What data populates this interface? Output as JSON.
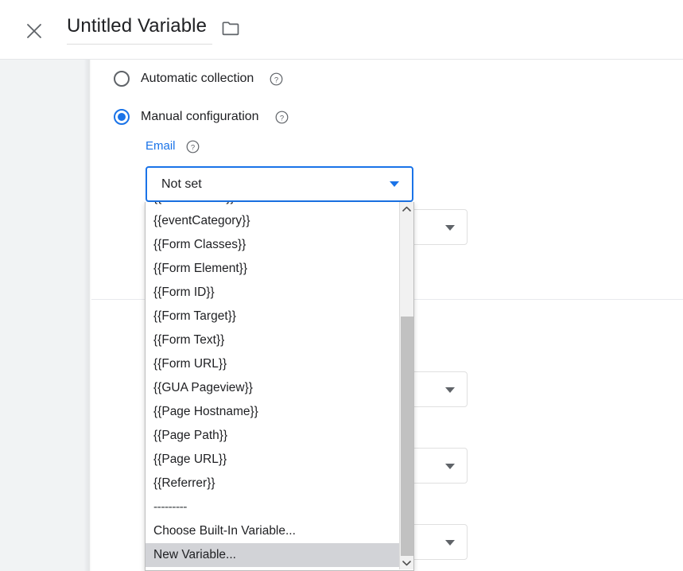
{
  "header": {
    "close_label": "close-icon",
    "title": "Untitled Variable",
    "folder_label": "folder-icon"
  },
  "colors": {
    "accent_blue": "#1a73e8",
    "text_primary": "#202124",
    "rail_gray": "#f1f3f4",
    "highlight_gray": "#d2d3d7",
    "scrollbar_thumb": "#c1c1c1"
  },
  "main": {
    "radio_options": [
      {
        "label": "Automatic collection",
        "selected": false
      },
      {
        "label": "Manual configuration",
        "selected": true
      }
    ],
    "email_field": {
      "label": "Email",
      "value": "Not set",
      "placeholder": "Not set"
    }
  },
  "dropdown": {
    "clipped_top_item": "{{eventAction}}",
    "items": [
      "{{eventCategory}}",
      "{{Form Classes}}",
      "{{Form Element}}",
      "{{Form ID}}",
      "{{Form Target}}",
      "{{Form Text}}",
      "{{Form URL}}",
      "{{GUA Pageview}}",
      "{{Page Hostname}}",
      "{{Page Path}}",
      "{{Page URL}}",
      "{{Referrer}}"
    ],
    "separator": "---------",
    "actions": [
      {
        "label": "Choose Built-In Variable...",
        "highlighted": false
      },
      {
        "label": "New Variable...",
        "highlighted": true
      }
    ],
    "scrollbar": {
      "up_arrow": "chevron-up-icon",
      "down_arrow": "chevron-down-icon"
    }
  }
}
